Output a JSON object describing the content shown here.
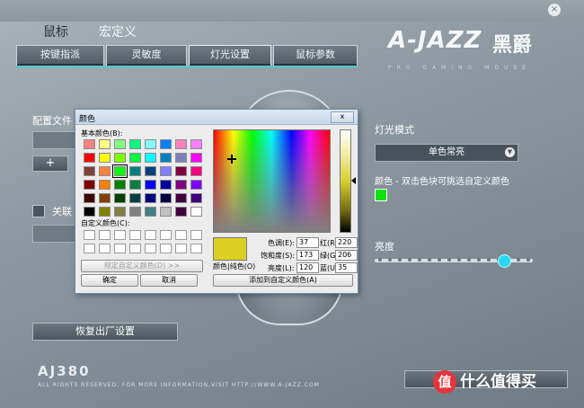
{
  "window": {
    "close_glyph": "×"
  },
  "main_tabs": {
    "mouse": "鼠标",
    "macro": "宏定义"
  },
  "sub_tabs": [
    {
      "label": "按键指派"
    },
    {
      "label": "灵敏度"
    },
    {
      "label": "灯光设置"
    },
    {
      "label": "鼠标参数"
    }
  ],
  "brand": {
    "logo_text": "A-JAZZ",
    "logo_cn": "黑爵",
    "tagline": "PRO GAMING MOUSE"
  },
  "left_panel": {
    "profile_label": "配置文件",
    "plus_label": "+",
    "link_label": "关联",
    "restore_button": "恢复出厂设置"
  },
  "right_panel": {
    "light_mode_label": "灯光模式",
    "light_mode_value": "单色常亮",
    "color_label": "颜色 - 双击色块可挑选自定义颜色",
    "brightness_label": "亮度",
    "brightness_level": 0.83,
    "selected_color": "#12e012"
  },
  "footer": {
    "model": "AJ380",
    "copyright": "ALL RIGHTS RESERVED. FOR MORE INFORMATION,VISIT HTTP://WWW.A-JAZZ.COM"
  },
  "watermark": {
    "icon_text": "值",
    "text": "什么值得买"
  },
  "color_dialog": {
    "title": "颜色",
    "close_glyph": "x",
    "basic_colors_label": "基本颜色(B):",
    "custom_colors_label": "自定义颜色(C):",
    "define_custom_button": "规定自定义颜色(D) >>",
    "ok_button": "确定",
    "cancel_button": "取消",
    "preview_label": "颜色|纯色(O)",
    "add_custom_button": "添加到自定义颜色(A)",
    "fields": {
      "hue_label": "色调(E):",
      "hue": "37",
      "sat_label": "饱和度(S):",
      "sat": "173",
      "lum_label": "亮度(L):",
      "lum": "120",
      "red_label": "红(R):",
      "red": "220",
      "green_label": "绿(G):",
      "green": "206",
      "blue_label": "蓝(U):",
      "blue": "35"
    },
    "basic_colors": [
      "#ff8080",
      "#ffff80",
      "#80ff80",
      "#00ff80",
      "#80ffff",
      "#0080ff",
      "#ff80c0",
      "#ff80ff",
      "#ff0000",
      "#ffff00",
      "#80ff00",
      "#00ff40",
      "#00ffff",
      "#0080c0",
      "#8080c0",
      "#ff00ff",
      "#804040",
      "#ff8040",
      "#00ff00",
      "#008080",
      "#004080",
      "#8080ff",
      "#800040",
      "#ff0080",
      "#800000",
      "#ff8000",
      "#008000",
      "#008040",
      "#0000ff",
      "#0000a0",
      "#800080",
      "#8000ff",
      "#400000",
      "#804000",
      "#004000",
      "#004040",
      "#000080",
      "#000040",
      "#400040",
      "#400080",
      "#000000",
      "#808000",
      "#808040",
      "#808080",
      "#408080",
      "#c0c0c0",
      "#400040",
      "#ffffff"
    ],
    "selected_basic_index": 18,
    "custom_colors": [
      "#ffffff",
      "#ffffff",
      "#ffffff",
      "#ffffff",
      "#ffffff",
      "#ffffff",
      "#ffffff",
      "#ffffff",
      "#ffffff",
      "#ffffff",
      "#ffffff",
      "#ffffff",
      "#ffffff",
      "#ffffff",
      "#ffffff",
      "#ffffff"
    ],
    "preview_color": "#dccf23"
  }
}
